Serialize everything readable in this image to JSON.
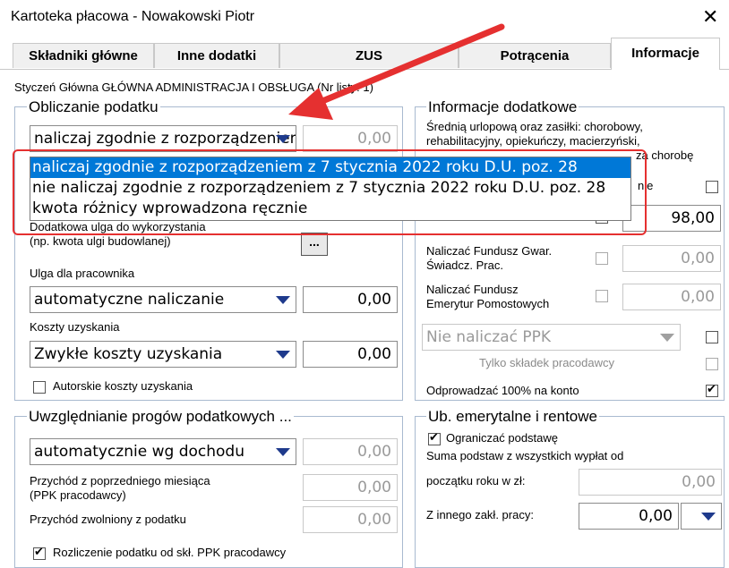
{
  "window": {
    "title": "Kartoteka płacowa - Nowakowski Piotr",
    "close_glyph": "✕"
  },
  "tabs": [
    {
      "label": "Składniki główne"
    },
    {
      "label": "Inne dodatki"
    },
    {
      "label": "ZUS"
    },
    {
      "label": "Potrącenia"
    },
    {
      "label": "Informacje",
      "active": true
    }
  ],
  "context_line": "Styczeń Główna GŁÓWNA ADMINISTRACJA I OBSŁUGA  (Nr listy: 1)",
  "obliczanie": {
    "title": "Obliczanie podatku",
    "combo_value": "naliczaj zgodnie z rozporządzeniem z 7 stycznia 2022 roku D.U. poz. 28",
    "combo_amount": "0,00",
    "dropdown_options": [
      "naliczaj zgodnie z rozporządzeniem z 7 stycznia 2022 roku D.U. poz. 28",
      "nie naliczaj zgodnie z rozporządzeniem z 7 stycznia 2022 roku D.U. poz. 28",
      "kwota różnicy wprowadzona ręcznie"
    ],
    "ulga_label_1": "Dodatkowa ulga do wykorzystania",
    "ulga_label_2": "(np. kwota ulgi budowlanej)",
    "dots_label": "...",
    "ulga_pracownika_label": "Ulga dla pracownika",
    "ulga_pracownika_value": "automatyczne naliczanie",
    "ulga_pracownika_amount": "0,00",
    "koszty_label": "Koszty uzyskania",
    "koszty_value": "Zwykłe koszty uzyskania",
    "koszty_amount": "0,00",
    "autorskie_label": "Autorskie koszty uzyskania"
  },
  "progi": {
    "title": "Uwzględnianie progów podatkowych ...",
    "combo_value": "automatycznie wg dochodu",
    "combo_amount": "0,00",
    "przychod_label_1": "Przychód z poprzedniego miesiąca",
    "przychod_label_2": "(PPK pracodawcy)",
    "przychod_amount": "0,00",
    "zwolniony_label": "Przychód zwolniony z podatku",
    "zwolniony_amount": "0,00",
    "rozliczenie_label": "Rozliczenie podatku od skł. PPK pracodawcy"
  },
  "informacje": {
    "title": "Informacje dodatkowe",
    "srednia_1": "Średnią urlopową oraz zasiłki: chorobowy,",
    "srednia_2": "rehabilitacyjny, opiekuńczy, macierzyński,",
    "srednia_3": "za chorobę",
    "srednia_4": "nie",
    "srednia_amount": "98,00",
    "fundusz_gwar_1": "Naliczać Fundusz Gwar.",
    "fundusz_gwar_2": "Świadcz. Prac.",
    "fundusz_gwar_amount": "0,00",
    "fundusz_em_1": "Naliczać Fundusz",
    "fundusz_em_2": "Emerytur Pomostowych",
    "fundusz_em_amount": "0,00",
    "ppk_value": "Nie naliczać PPK",
    "tylko_label": "Tylko składek pracodawcy",
    "odprowadzac_label": "Odprowadzać 100% na konto"
  },
  "emerytalne": {
    "title": "Ub. emerytalne i rentowe",
    "ograniczac_label": "Ograniczać podstawę",
    "suma_label_1": "Suma podstaw z wszystkich wypłat od",
    "suma_label_2": "początku roku w zł:",
    "suma_amount": "0,00",
    "inny_label": "Z innego zakł. pracy:",
    "inny_amount": "0,00"
  },
  "colors": {
    "accent_selection": "#0078d7",
    "highlight_annotation": "#e53030",
    "combo_arrow": "#1e3a8c"
  }
}
